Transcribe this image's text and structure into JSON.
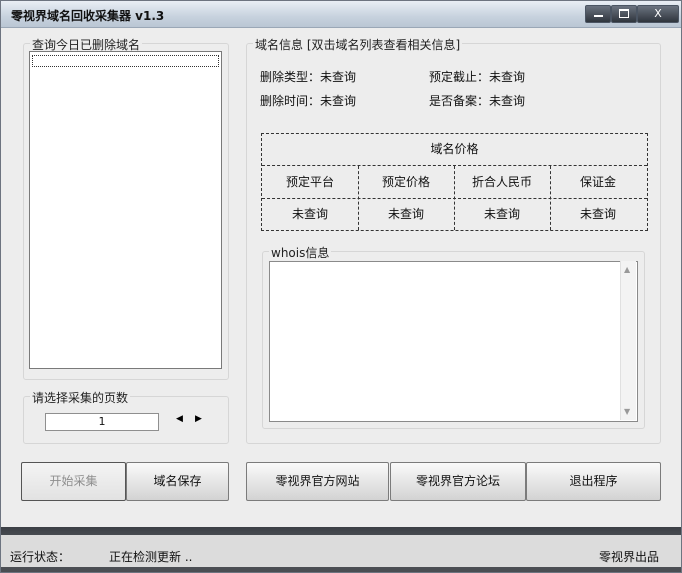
{
  "window": {
    "title": "零视界域名回收采集器 v1.3",
    "close_label": "X"
  },
  "left_panel": {
    "legend": "查询今日已删除域名",
    "items": []
  },
  "pages": {
    "legend": "请选择采集的页数",
    "value": "1",
    "left_arrow": "◀",
    "right_arrow": "▶"
  },
  "domain_info": {
    "legend": "域名信息 [双击域名列表查看相关信息]",
    "delete_type": "删除类型：未查询",
    "reserve_deadline": "预定截止：未查询",
    "delete_time": "删除时间：未查询",
    "filing": "是否备案：未查询"
  },
  "price": {
    "title": "域名价格",
    "headers": [
      "预定平台",
      "预定价格",
      "折合人民币",
      "保证金"
    ],
    "values": [
      "未查询",
      "未查询",
      "未查询",
      "未查询"
    ]
  },
  "whois": {
    "legend": "whois信息",
    "content": ""
  },
  "buttons": {
    "start": "开始采集",
    "save": "域名保存",
    "website": "零视界官方网站",
    "forum": "零视界官方论坛",
    "exit": "退出程序"
  },
  "status": {
    "label": "运行状态：",
    "text": "正在检测更新 ..",
    "credit": "零视界出品"
  }
}
